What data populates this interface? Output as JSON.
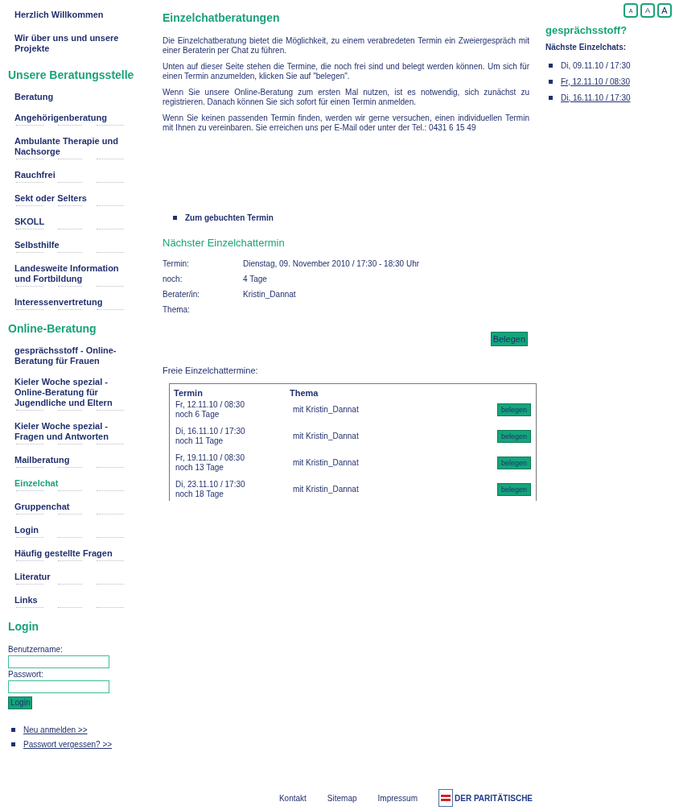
{
  "top_links": [
    {
      "label": "Herzlich Willkommen"
    },
    {
      "label": "Wir über uns und unsere Projekte"
    }
  ],
  "nav_sections": [
    {
      "title": "Unsere Beratungsstelle",
      "items": [
        {
          "label": "Beratung",
          "selected": false
        },
        {
          "label": "Angehörigenberatung",
          "selected": false
        },
        {
          "label": "Ambulante Therapie und Nachsorge",
          "selected": false
        },
        {
          "label": "Rauchfrei",
          "selected": false
        },
        {
          "label": "Sekt oder Selters",
          "selected": false
        },
        {
          "label": "SKOLL",
          "selected": false
        },
        {
          "label": "Selbsthilfe",
          "selected": false
        },
        {
          "label": "Landesweite Information und Fortbildung",
          "selected": false
        },
        {
          "label": "Interessenvertretung",
          "selected": false
        }
      ]
    },
    {
      "title": "Online-Beratung",
      "items": [
        {
          "label": "gesprächsstoff - Online-Beratung für Frauen",
          "selected": false
        },
        {
          "label": "Kieler Woche spezial - Online-Beratung für Jugendliche und Eltern",
          "selected": false
        },
        {
          "label": "Kieler Woche spezial - Fragen und Antworten",
          "selected": false
        },
        {
          "label": "Mailberatung",
          "selected": false
        },
        {
          "label": "Einzelchat",
          "selected": true
        },
        {
          "label": "Gruppenchat",
          "selected": false
        },
        {
          "label": "Login",
          "selected": false
        },
        {
          "label": "Häufig gestellte Fragen",
          "selected": false
        },
        {
          "label": "Literatur",
          "selected": false
        },
        {
          "label": "Links",
          "selected": false
        }
      ]
    }
  ],
  "login": {
    "title": "Login",
    "username_label": "Benutzername:",
    "password_label": "Passwort:",
    "button": "Login",
    "links": [
      "Neu anmelden >>",
      "Passwort vergessen? >>"
    ]
  },
  "main": {
    "title": "Einzelchatberatungen",
    "paragraphs": [
      "Die Einzelchatberatung bietet die Möglichkeit, zu einem verabredeten Termin ein Zweiergespräch mit einer Beraterin per Chat zu führen.",
      "Unten auf dieser Seite stehen die Termine, die noch frei sind und belegt werden können. Um sich für einen Termin anzumelden, klicken Sie auf \"belegen\".",
      "Wenn Sie unsere Online-Beratung zum ersten Mal nutzen, ist es notwendig, sich zunächst zu registrieren. Danach können Sie sich sofort für einen Termin anmelden.",
      "Wenn Sie keinen passenden Termin finden, werden wir gerne versuchen, einen individuellen Termin mit Ihnen zu vereinbaren. Sie erreichen uns per E-Mail oder unter der Tel.: 0431 6 15 49"
    ],
    "booked_link": "Zum gebuchten Termin",
    "next_title": "Nächster Einzelchattermin",
    "details": [
      {
        "label": "Termin:",
        "value": "Dienstag, 09. November 2010 / 17:30 - 18:30 Uhr"
      },
      {
        "label": "noch:",
        "value": "4 Tage"
      },
      {
        "label": "Berater/in:",
        "value": "Kristin_Dannat"
      },
      {
        "label": "Thema:"
      }
    ],
    "book_button": "Belegen",
    "free_title": "Freie Einzelchattermine:",
    "columns": [
      "Termin",
      "Thema"
    ],
    "rows": [
      {
        "date": "Fr, 12.11.10 / 08:30",
        "remaining": "noch 6 Tage",
        "topic": "mit Kristin_Dannat",
        "button": "belegen"
      },
      {
        "date": "Di, 16.11.10 / 17:30",
        "remaining": "noch 11 Tage",
        "topic": "mit Kristin_Dannat",
        "button": "belegen"
      },
      {
        "date": "Fr, 19.11.10 / 08:30",
        "remaining": "noch 13 Tage",
        "topic": "mit Kristin_Dannat",
        "button": "belegen"
      },
      {
        "date": "Di, 23.11.10 / 17:30",
        "remaining": "noch 18 Tage",
        "topic": "mit Kristin_Dannat",
        "button": "belegen"
      }
    ]
  },
  "font_buttons": [
    "A",
    "A",
    "A"
  ],
  "sidebar": {
    "title": "gesprächsstoff?",
    "subtitle": "Nächste Einzelchats:",
    "links": [
      {
        "label": "Di, 09.11.10 / 17:30",
        "underlined": false
      },
      {
        "label": "Fr, 12.11.10 / 08:30",
        "underlined": true
      },
      {
        "label": "Di, 16.11.10 / 17:30",
        "underlined": true
      }
    ]
  },
  "footer": {
    "links": [
      "Kontakt",
      "Sitemap",
      "Impressum"
    ],
    "logo": "DER PARITÄTISCHE"
  }
}
